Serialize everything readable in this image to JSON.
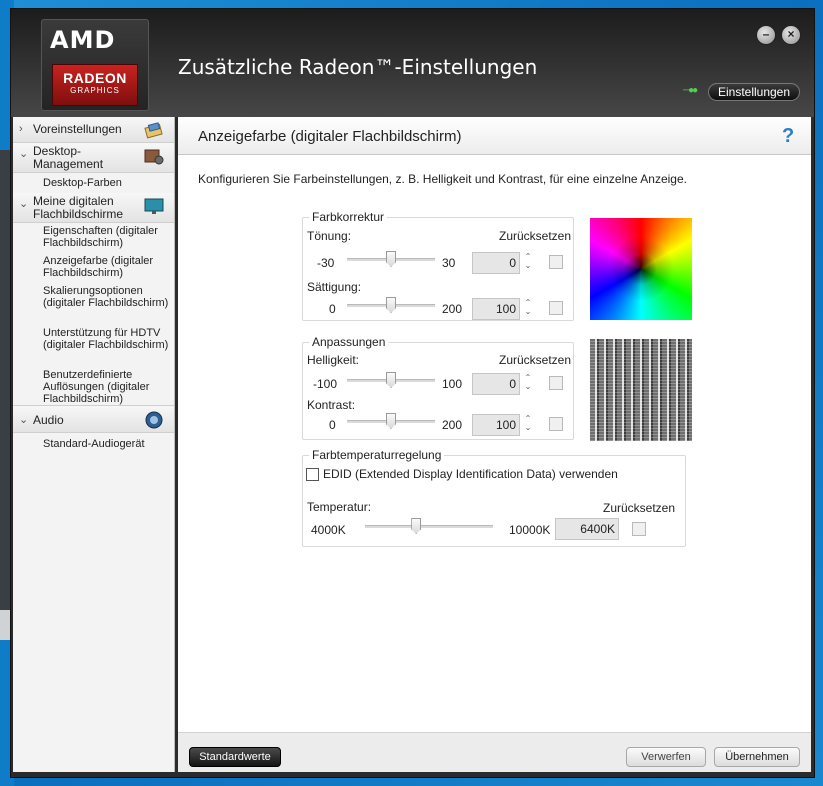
{
  "window": {
    "logo_brand": "AMD",
    "logo_product": "RADEON",
    "logo_sub": "GRAPHICS",
    "title": "Zusätzliche Radeon™-Einstellungen",
    "minimize": "–",
    "close": "×",
    "settings_button": "Einstellungen"
  },
  "sidebar": {
    "voreinstellungen": "Voreinstellungen",
    "desktop_management": "Desktop-Management",
    "desktop_farben": "Desktop-Farben",
    "meine_digitalen": "Meine digitalen Flachbildschirme",
    "sub_items": [
      "Eigenschaften (digitaler Flachbildschirm)",
      "Anzeigefarbe (digitaler Flachbildschirm)",
      "Skalierungsoptionen (digitaler Flachbildschirm)",
      "Unterstützung für HDTV (digitaler Flachbildschirm)",
      "Benutzerdefinierte Auflösungen (digitaler Flachbildschirm)"
    ],
    "audio": "Audio",
    "standard_audio": "Standard-Audiogerät"
  },
  "content": {
    "title": "Anzeigefarbe (digitaler Flachbildschirm)",
    "help": "?",
    "description": "Konfigurieren Sie Farbeinstellungen, z. B. Helligkeit und Kontrast, für eine einzelne Anzeige.",
    "farbkorrektur": {
      "legend": "Farbkorrektur",
      "reset_label": "Zurücksetzen",
      "toenung": {
        "label": "Tönung:",
        "min": "-30",
        "max": "30",
        "value": "0",
        "level": 0.5
      },
      "saettigung": {
        "label": "Sättigung:",
        "min": "0",
        "max": "200",
        "value": "100",
        "level": 0.5
      }
    },
    "anpassungen": {
      "legend": "Anpassungen",
      "reset_label": "Zurücksetzen",
      "helligkeit": {
        "label": "Helligkeit:",
        "min": "-100",
        "max": "100",
        "value": "0",
        "level": 0.5
      },
      "kontrast": {
        "label": "Kontrast:",
        "min": "0",
        "max": "200",
        "value": "100",
        "level": 0.5
      }
    },
    "farbtemperatur": {
      "legend": "Farbtemperaturregelung",
      "edid_label": "EDID (Extended Display Identification Data) verwenden",
      "temp_label": "Temperatur:",
      "reset_label": "Zurücksetzen",
      "min": "4000K",
      "max": "10000K",
      "value": "6400K",
      "level": 0.4
    },
    "footer": {
      "standardwerte": "Standardwerte",
      "verwerfen": "Verwerfen",
      "uebernehmen": "Übernehmen"
    }
  }
}
